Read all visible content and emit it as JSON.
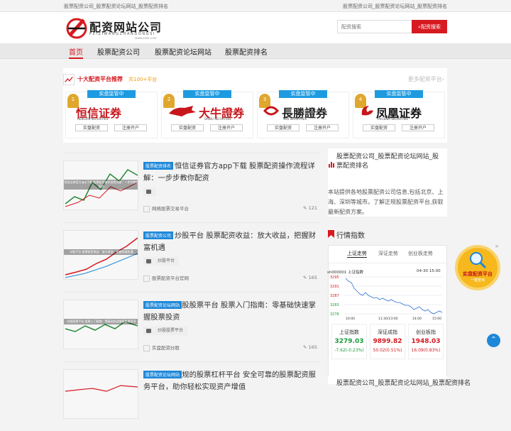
{
  "topbar": {
    "left": "股票配资公司_股票配资论坛网站_股票配资排名",
    "right": "股票配资公司_股票配资论坛网站_股票配资排名"
  },
  "logo": {
    "cn": "配资网站公司",
    "pinyin": "PEIZIWANGZHANGONGSI",
    "url": "WWW.XXXX.COM"
  },
  "search": {
    "placeholder": "配资搜索",
    "button": "配资搜索"
  },
  "nav": [
    "首页",
    "股票配资公司",
    "股票配资论坛网站",
    "股票配资排名"
  ],
  "panel": {
    "title": "十大配资平台推荐",
    "count": "共100+平台",
    "more": "更多配资平台"
  },
  "brokers": [
    {
      "tag": "实盘监管中",
      "rank": "1",
      "name": "恒信证券",
      "en": "HENGXIN SECURITIES",
      "b1": "实盘配资",
      "b2": "注册开户",
      "color": "#c8161d"
    },
    {
      "tag": "实盘监管中",
      "rank": "2",
      "name": "大牛證券",
      "en": "DANIU SECURITIES",
      "b1": "实盘配资",
      "b2": "注册开户",
      "color": "#c8161d"
    },
    {
      "tag": "实盘监管中",
      "rank": "3",
      "name": "長勝證券",
      "en": "WIN SECURITIES",
      "b1": "实盘配资",
      "b2": "注册开户",
      "color": "#222222"
    },
    {
      "tag": "实盘监管中",
      "rank": "4",
      "name": "凤凰证券",
      "en": "PHOENIX SECURITIES",
      "b1": "实盘配资",
      "b2": "注册开户",
      "color": "#111111"
    }
  ],
  "posts": [
    {
      "category": "股票配资排名",
      "title": "恒信证券官方app下载 股票配资操作流程详解：一步步教你配资",
      "tag": "",
      "source": "网络股票交易平台",
      "views": "121",
      "thumb_caption": "恒信证券官方app下载 股票配资操作流程详解：一步步教你配资"
    },
    {
      "category": "股票配资公司",
      "title": "炒股平台 股票配资收益：放大收益，把握财富机遇",
      "tag": "炒股平台",
      "source": "股票配资平台官网",
      "views": "165",
      "thumb_caption": "炒股平台 股票配资收益：放大收益，把握财富机遇"
    },
    {
      "category": "股票配资论坛网站",
      "title": "炒股股票平台 股票入门指南：零基础快速掌握股票投资",
      "tag": "炒股股票平台",
      "source": "实盘配资炒股",
      "views": "165",
      "thumb_caption": "炒股股票平台 股票入门指南：零基础快速掌握股票投资"
    },
    {
      "category": "股票配资论坛网站",
      "title": "正规的股票杠杆平台 安全可靠的股票配资服务平台，助你轻松实现资产增值",
      "tag": "",
      "source": "",
      "views": "",
      "thumb_caption": ""
    }
  ],
  "side": {
    "heading": "股票配资公司_股票配资论坛网站_股票配资排名",
    "desc": "本站提供各地股票配资公司信息,包括北京、上海、深圳等城市。了解正规股票配资平台,获取最新配资方案。",
    "trend_title": "行情指数",
    "tabs": [
      "上证走势",
      "深证走势",
      "创业板走势"
    ],
    "chart_label": "sh000001  上证指数",
    "chart_time": "04-30 15:00",
    "yticks": [
      "3295",
      "3291",
      "3287",
      "3283",
      "3278"
    ],
    "xticks": [
      "10:00",
      "11:30/13:00",
      "14:00",
      "15:00"
    ],
    "indices": [
      {
        "name": "上证指数",
        "value": "3279.03",
        "change": "-7.62(-0.23%)",
        "color": "#1b9a3c"
      },
      {
        "name": "深证成指",
        "value": "9899.82",
        "change": "50.02(0.51%)",
        "color": "#d71920"
      },
      {
        "name": "创业板指",
        "value": "1948.03",
        "change": "16.09(0.83%)",
        "color": "#d71920"
      }
    ],
    "bottom_heading": "股票配资公司_股票配资论坛网站_股票配资排名"
  },
  "float": {
    "title": "实盘配资平台",
    "sub": "一键查询",
    "close": "×"
  },
  "totop": "⌃"
}
